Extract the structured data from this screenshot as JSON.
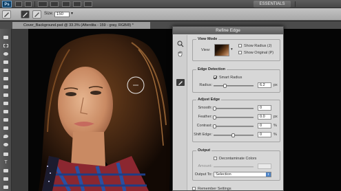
{
  "app": {
    "logo": "Ps",
    "workspace": "ESSENTIALS"
  },
  "options_bar": {
    "size_label": "Size:",
    "size_value": "150"
  },
  "document": {
    "tab_title": "Cover_Background.psd @ 33.3% (Afterdita - 159 - gray, RGB/8) *"
  },
  "dialog": {
    "title": "Refine Edge",
    "view_mode": {
      "heading": "View Mode",
      "view_label": "View:",
      "show_radius": "Show Radius (J)",
      "show_original": "Show Original (P)"
    },
    "edge_detection": {
      "heading": "Edge Detection",
      "smart_radius": "Smart Radius",
      "smart_radius_checked": true,
      "radius_label": "Radius:",
      "radius_value": "6.2",
      "radius_unit": "px",
      "radius_fraction": 0.3
    },
    "adjust_edge": {
      "heading": "Adjust Edge",
      "smooth_label": "Smooth:",
      "smooth_value": "0",
      "feather_label": "Feather:",
      "feather_value": "0.0",
      "feather_unit": "px",
      "contrast_label": "Contrast:",
      "contrast_value": "0",
      "contrast_unit": "%",
      "shift_label": "Shift Edge:",
      "shift_value": "0",
      "shift_unit": "%"
    },
    "output": {
      "heading": "Output",
      "decontaminate": "Decontaminate Colors",
      "amount_label": "Amount:",
      "output_to_label": "Output To:",
      "output_to_value": "Selection"
    },
    "remember": "Remember Settings"
  }
}
